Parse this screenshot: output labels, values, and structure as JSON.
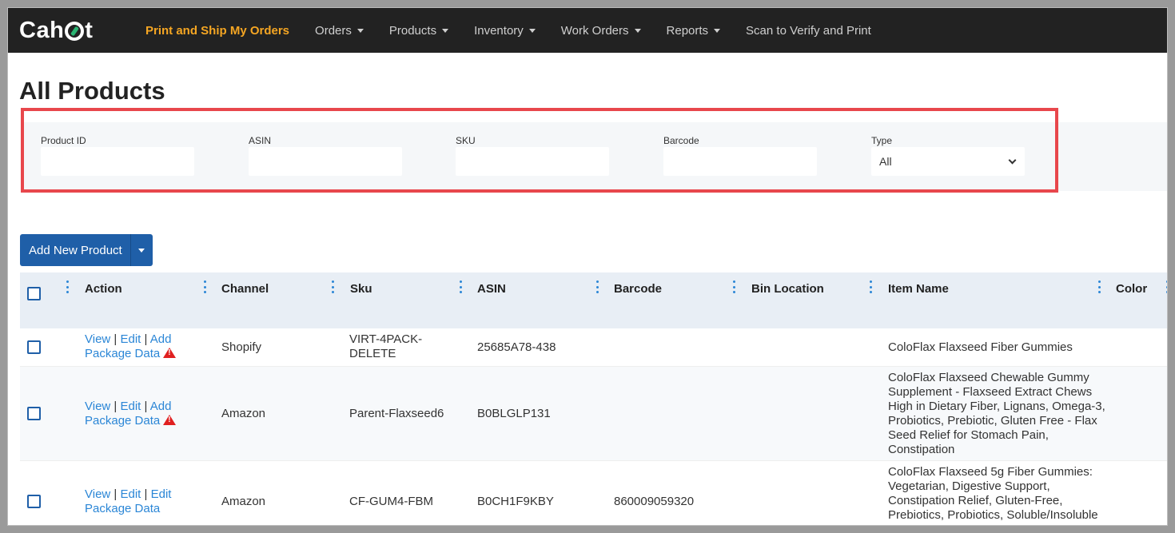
{
  "app": {
    "logo_prefix": "Cah",
    "logo_suffix": "t"
  },
  "nav": {
    "items": [
      {
        "label": "Print and Ship My Orders",
        "active": true,
        "dropdown": false
      },
      {
        "label": "Orders",
        "active": false,
        "dropdown": true
      },
      {
        "label": "Products",
        "active": false,
        "dropdown": true
      },
      {
        "label": "Inventory",
        "active": false,
        "dropdown": true
      },
      {
        "label": "Work Orders",
        "active": false,
        "dropdown": true
      },
      {
        "label": "Reports",
        "active": false,
        "dropdown": true
      },
      {
        "label": "Scan to Verify and Print",
        "active": false,
        "dropdown": false
      }
    ]
  },
  "page": {
    "title": "All Products"
  },
  "filters": {
    "product_id": {
      "label": "Product ID",
      "value": "",
      "placeholder": ""
    },
    "asin": {
      "label": "ASIN",
      "value": "",
      "placeholder": ""
    },
    "sku": {
      "label": "SKU",
      "value": "",
      "placeholder": ""
    },
    "barcode": {
      "label": "Barcode",
      "value": "",
      "placeholder": ""
    },
    "type": {
      "label": "Type",
      "selected": "All"
    }
  },
  "toolbar": {
    "add_label": "Add New Product"
  },
  "table": {
    "columns": [
      "Action",
      "Channel",
      "Sku",
      "ASIN",
      "Barcode",
      "Bin Location",
      "Item Name",
      "Color"
    ],
    "rows": [
      {
        "actions": {
          "view": "View",
          "edit": "Edit",
          "sep": "|",
          "extra_a": "Add",
          "extra_b": "Package Data",
          "warning": true
        },
        "channel": "Shopify",
        "sku": "VIRT-4PACK-DELETE",
        "asin": "25685A78-438",
        "barcode": "",
        "bin_location": "",
        "item_name": "ColoFlax Flaxseed Fiber Gummies",
        "color": ""
      },
      {
        "actions": {
          "view": "View",
          "edit": "Edit",
          "sep": "|",
          "extra_a": "Add",
          "extra_b": "Package Data",
          "warning": true
        },
        "channel": "Amazon",
        "sku": "Parent-Flaxseed6",
        "asin": "B0BLGLP131",
        "barcode": "",
        "bin_location": "",
        "item_name": "ColoFlax Flaxseed Chewable Gummy Supplement - Flaxseed Extract Chews High in Dietary Fiber, Lignans, Omega-3, Probiotics, Prebiotic, Gluten Free - Flax Seed Relief for Stomach Pain, Constipation",
        "color": ""
      },
      {
        "actions": {
          "view": "View",
          "edit": "Edit",
          "sep": "|",
          "extra_a": "Edit",
          "extra_b": "Package Data",
          "warning": false
        },
        "channel": "Amazon",
        "sku": "CF-GUM4-FBM",
        "asin": "B0CH1F9KBY",
        "barcode": "860009059320",
        "bin_location": "",
        "item_name": "ColoFlax Flaxseed 5g Fiber Gummies: Vegetarian, Digestive Support, Constipation Relief, Gluten-Free, Prebiotics, Probiotics, Soluble/Insoluble",
        "color": ""
      }
    ]
  },
  "colors": {
    "navbar": "#222222",
    "active_nav": "#f5a623",
    "primary": "#1f5fa8",
    "link": "#2b86d6",
    "highlight": "#e8474c",
    "warning": "#e02020"
  }
}
